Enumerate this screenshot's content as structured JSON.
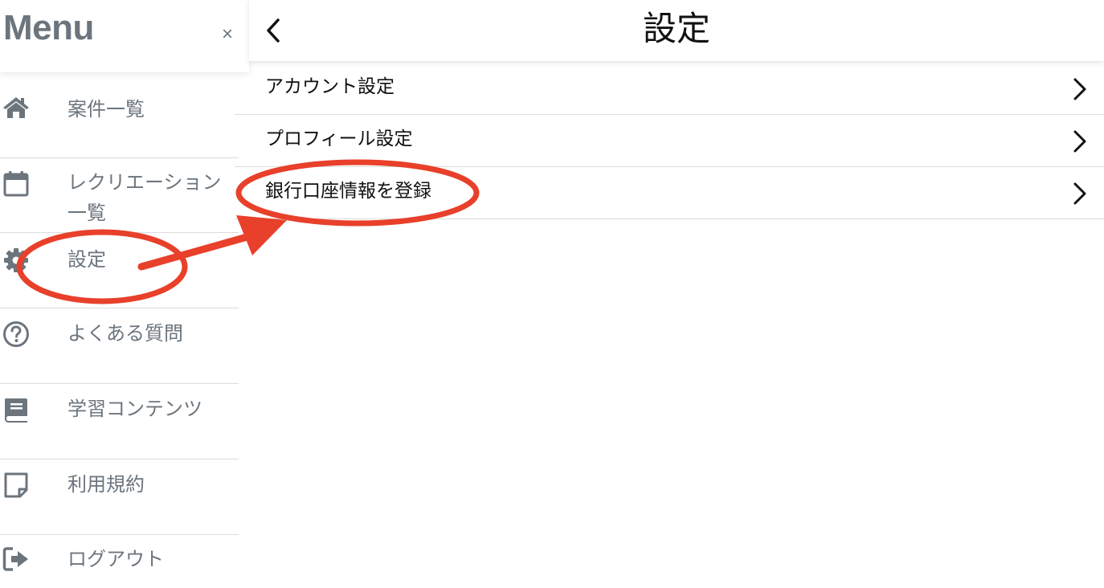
{
  "sidebar": {
    "title": "Menu",
    "close_label": "×",
    "items": [
      {
        "label": "案件一覧",
        "icon": "home-icon"
      },
      {
        "label": "レクリエーション一覧",
        "icon": "calendar-icon"
      },
      {
        "label": "設定",
        "icon": "gear-icon"
      },
      {
        "label": "よくある質問",
        "icon": "question-circle-icon"
      },
      {
        "label": "学習コンテンツ",
        "icon": "book-icon"
      },
      {
        "label": "利用規約",
        "icon": "sticky-note-icon"
      },
      {
        "label": "ログアウト",
        "icon": "sign-out-icon"
      }
    ]
  },
  "header": {
    "title": "設定",
    "back_icon": "chevron-left-icon"
  },
  "settings": {
    "items": [
      {
        "label": "アカウント設定"
      },
      {
        "label": "プロフィール設定"
      },
      {
        "label": "銀行口座情報を登録"
      }
    ]
  },
  "colors": {
    "sidebar_text": "#6c757d",
    "main_text": "#111111",
    "divider": "#dcdcdc",
    "annotation": "#e8402a"
  }
}
